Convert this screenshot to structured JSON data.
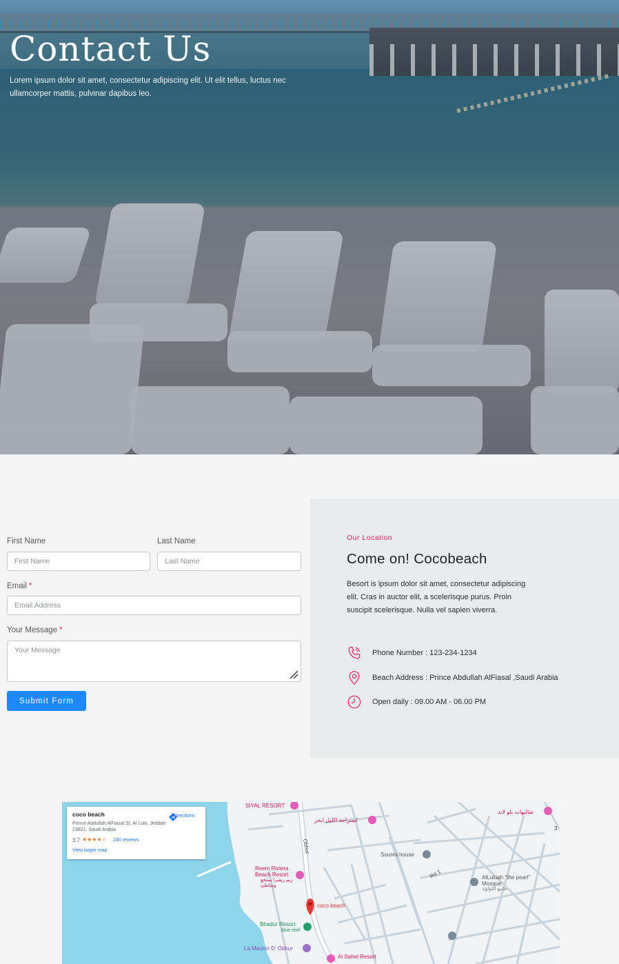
{
  "hero": {
    "title": "Contact Us",
    "subtitle": "Lorem ipsum dolor sit amet, consectetur adipiscing elit. Ut elit tellus, luctus nec ullamcorper mattis, pulvinar dapibus leo."
  },
  "form": {
    "first_name_label": "First Name",
    "first_name_placeholder": "First Name",
    "last_name_label": "Last Name",
    "last_name_placeholder": "Last Name",
    "email_label": "Email",
    "email_placeholder": "Email Address",
    "message_label": "Your Message",
    "message_placeholder": "Your Message",
    "required_mark": "*",
    "submit_label": "Submit Form"
  },
  "location": {
    "eyebrow": "Our Location",
    "title": "Come on! Cocobeach",
    "description": "Besort is ipsum dolor sit amet, consectetur adipiscing elit. Cras in auctor elit, a scelerisque purus. Proin suscipit scelerisque. Nulla vel sapien viverra.",
    "phone": "Phone Number : 123-234-1234",
    "address": "Beach Address : Prince Abdullah AlFiasal ,Saudi Arabia",
    "hours": "Open daily : 09.00 AM - 06.00 PM",
    "accent_color": "#e0245e"
  },
  "map": {
    "place_name": "coco beach",
    "place_address": "Prince Abdullah AlFiasal St, Al Lulu, Jeddah 23821, Saudi Arabia",
    "rating": "3.7",
    "stars": "★★★★☆",
    "reviews": "240 reviews",
    "larger_map": "View larger map",
    "directions": "Directions",
    "labels": {
      "siyal": "SIYAL RESORT",
      "arabic_top": "شاليهات بلو لاند",
      "arabic_ikleel": "استراحة اكليل ابحر",
      "obhur": "Obhur",
      "sounni": "Sounni house",
      "rd1": "Rd 1",
      "reem": "Reem Riviera Beach Resort",
      "reem_ar": "ريم ريفيرا منتجع وشاطئ",
      "mosque": "AlLuluah \"the pearl\" Mosque",
      "mosque_ar": "جامع اللؤلؤة",
      "coco": "coco beach",
      "bhadur": "Bhadur Resort",
      "blue_reef": "blue reef",
      "masion": "La Masion D' Obhur",
      "sahel": "Al Sahel Resort",
      "three": "3"
    }
  }
}
